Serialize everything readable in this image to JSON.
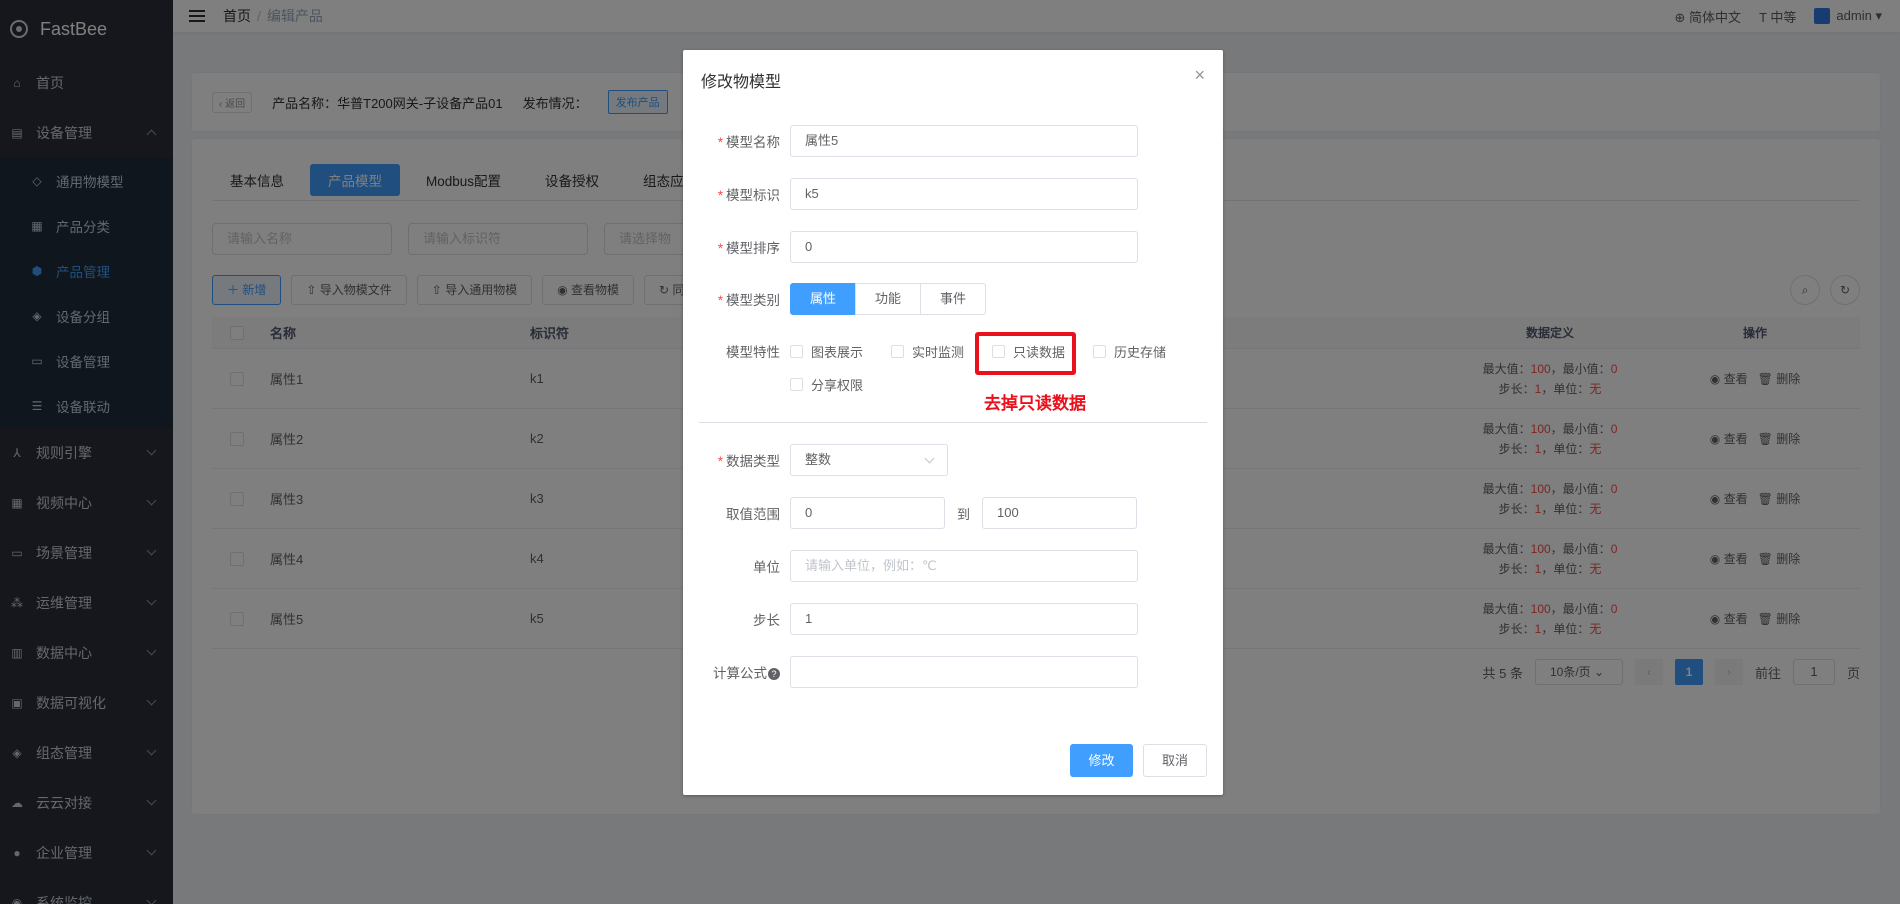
{
  "app": {
    "name": "FastBee"
  },
  "sidebar": {
    "items": [
      {
        "label": "首页",
        "icon": "home-icon"
      },
      {
        "label": "设备管理",
        "icon": "device-icon",
        "expanded": true
      },
      {
        "label": "规则引擎",
        "icon": "rule-icon"
      },
      {
        "label": "视频中心",
        "icon": "video-icon"
      },
      {
        "label": "场景管理",
        "icon": "scene-icon"
      },
      {
        "label": "运维管理",
        "icon": "ops-icon"
      },
      {
        "label": "数据中心",
        "icon": "data-icon"
      },
      {
        "label": "数据可视化",
        "icon": "visual-icon"
      },
      {
        "label": "组态管理",
        "icon": "config-icon"
      },
      {
        "label": "云云对接",
        "icon": "cloud-icon"
      },
      {
        "label": "企业管理",
        "icon": "enterprise-icon"
      },
      {
        "label": "系统监控",
        "icon": "monitor-icon"
      }
    ],
    "subitems": [
      {
        "label": "通用物模型"
      },
      {
        "label": "产品分类"
      },
      {
        "label": "产品管理",
        "active": true
      },
      {
        "label": "设备分组"
      },
      {
        "label": "设备管理"
      },
      {
        "label": "设备联动"
      }
    ]
  },
  "header": {
    "breadcrumb": {
      "home": "首页",
      "sep": "/",
      "current": "编辑产品"
    },
    "lang": "简体中文",
    "size": "中等",
    "user": "admin"
  },
  "product": {
    "back": "返回",
    "name_label": "产品名称：",
    "name": "华普T200网关-子设备产品01",
    "publish_label": "发布情况：",
    "publish_tag": "发布产品"
  },
  "tabs": [
    "基本信息",
    "产品模型",
    "Modbus配置",
    "设备授权",
    "组态应用"
  ],
  "filters": {
    "name_ph": "请输入名称",
    "id_ph": "请输入标识符",
    "type_ph": "请选择物"
  },
  "toolbar": {
    "add": "新增",
    "import_file": "导入物模文件",
    "import_common": "导入通用物模",
    "view_model": "查看物模",
    "sync": "同"
  },
  "table": {
    "headers": {
      "name": "名称",
      "id": "标识符",
      "def": "数据定义",
      "ops": "操作"
    },
    "rows": [
      {
        "name": "属性1",
        "id": "k1",
        "max": "100",
        "min": "0",
        "step": "1",
        "unit": "无"
      },
      {
        "name": "属性2",
        "id": "k2",
        "max": "100",
        "min": "0",
        "step": "1",
        "unit": "无"
      },
      {
        "name": "属性3",
        "id": "k3",
        "max": "100",
        "min": "0",
        "step": "1",
        "unit": "无"
      },
      {
        "name": "属性4",
        "id": "k4",
        "max": "100",
        "min": "0",
        "step": "1",
        "unit": "无"
      },
      {
        "name": "属性5",
        "id": "k5",
        "max": "100",
        "min": "0",
        "step": "1",
        "unit": "无"
      }
    ],
    "max_label": "最大值：",
    "min_label": "，最小值：",
    "step_label": "步长：",
    "unit_label": "，单位：",
    "view": "查看",
    "delete": "删除"
  },
  "pager": {
    "total": "共 5 条",
    "page_size": "10条/页",
    "current": "1",
    "goto": "前往",
    "goto_value": "1",
    "page_unit": "页"
  },
  "dialog": {
    "title": "修改物模型",
    "close": "×",
    "fields": {
      "name_label": "模型名称",
      "name_value": "属性5",
      "id_label": "模型标识",
      "id_value": "k5",
      "order_label": "模型排序",
      "order_value": "0",
      "type_label": "模型类别",
      "types": [
        "属性",
        "功能",
        "事件"
      ],
      "feature_label": "模型特性",
      "features": [
        "图表展示",
        "实时监测",
        "只读数据",
        "历史存储",
        "分享权限"
      ],
      "datatype_label": "数据类型",
      "datatype_value": "整数",
      "range_label": "取值范围",
      "range_min": "0",
      "range_to": "到",
      "range_max": "100",
      "unit_label": "单位",
      "unit_ph": "请输入单位，例如：℃",
      "step_label": "步长",
      "step_value": "1",
      "formula_label": "计算公式",
      "formula_value": ""
    },
    "annotation": "去掉只读数据",
    "ok": "修改",
    "cancel": "取消"
  },
  "colors": {
    "primary": "#409eff",
    "highlight": "#e8111c",
    "sidebar": "#2b2f3a"
  }
}
